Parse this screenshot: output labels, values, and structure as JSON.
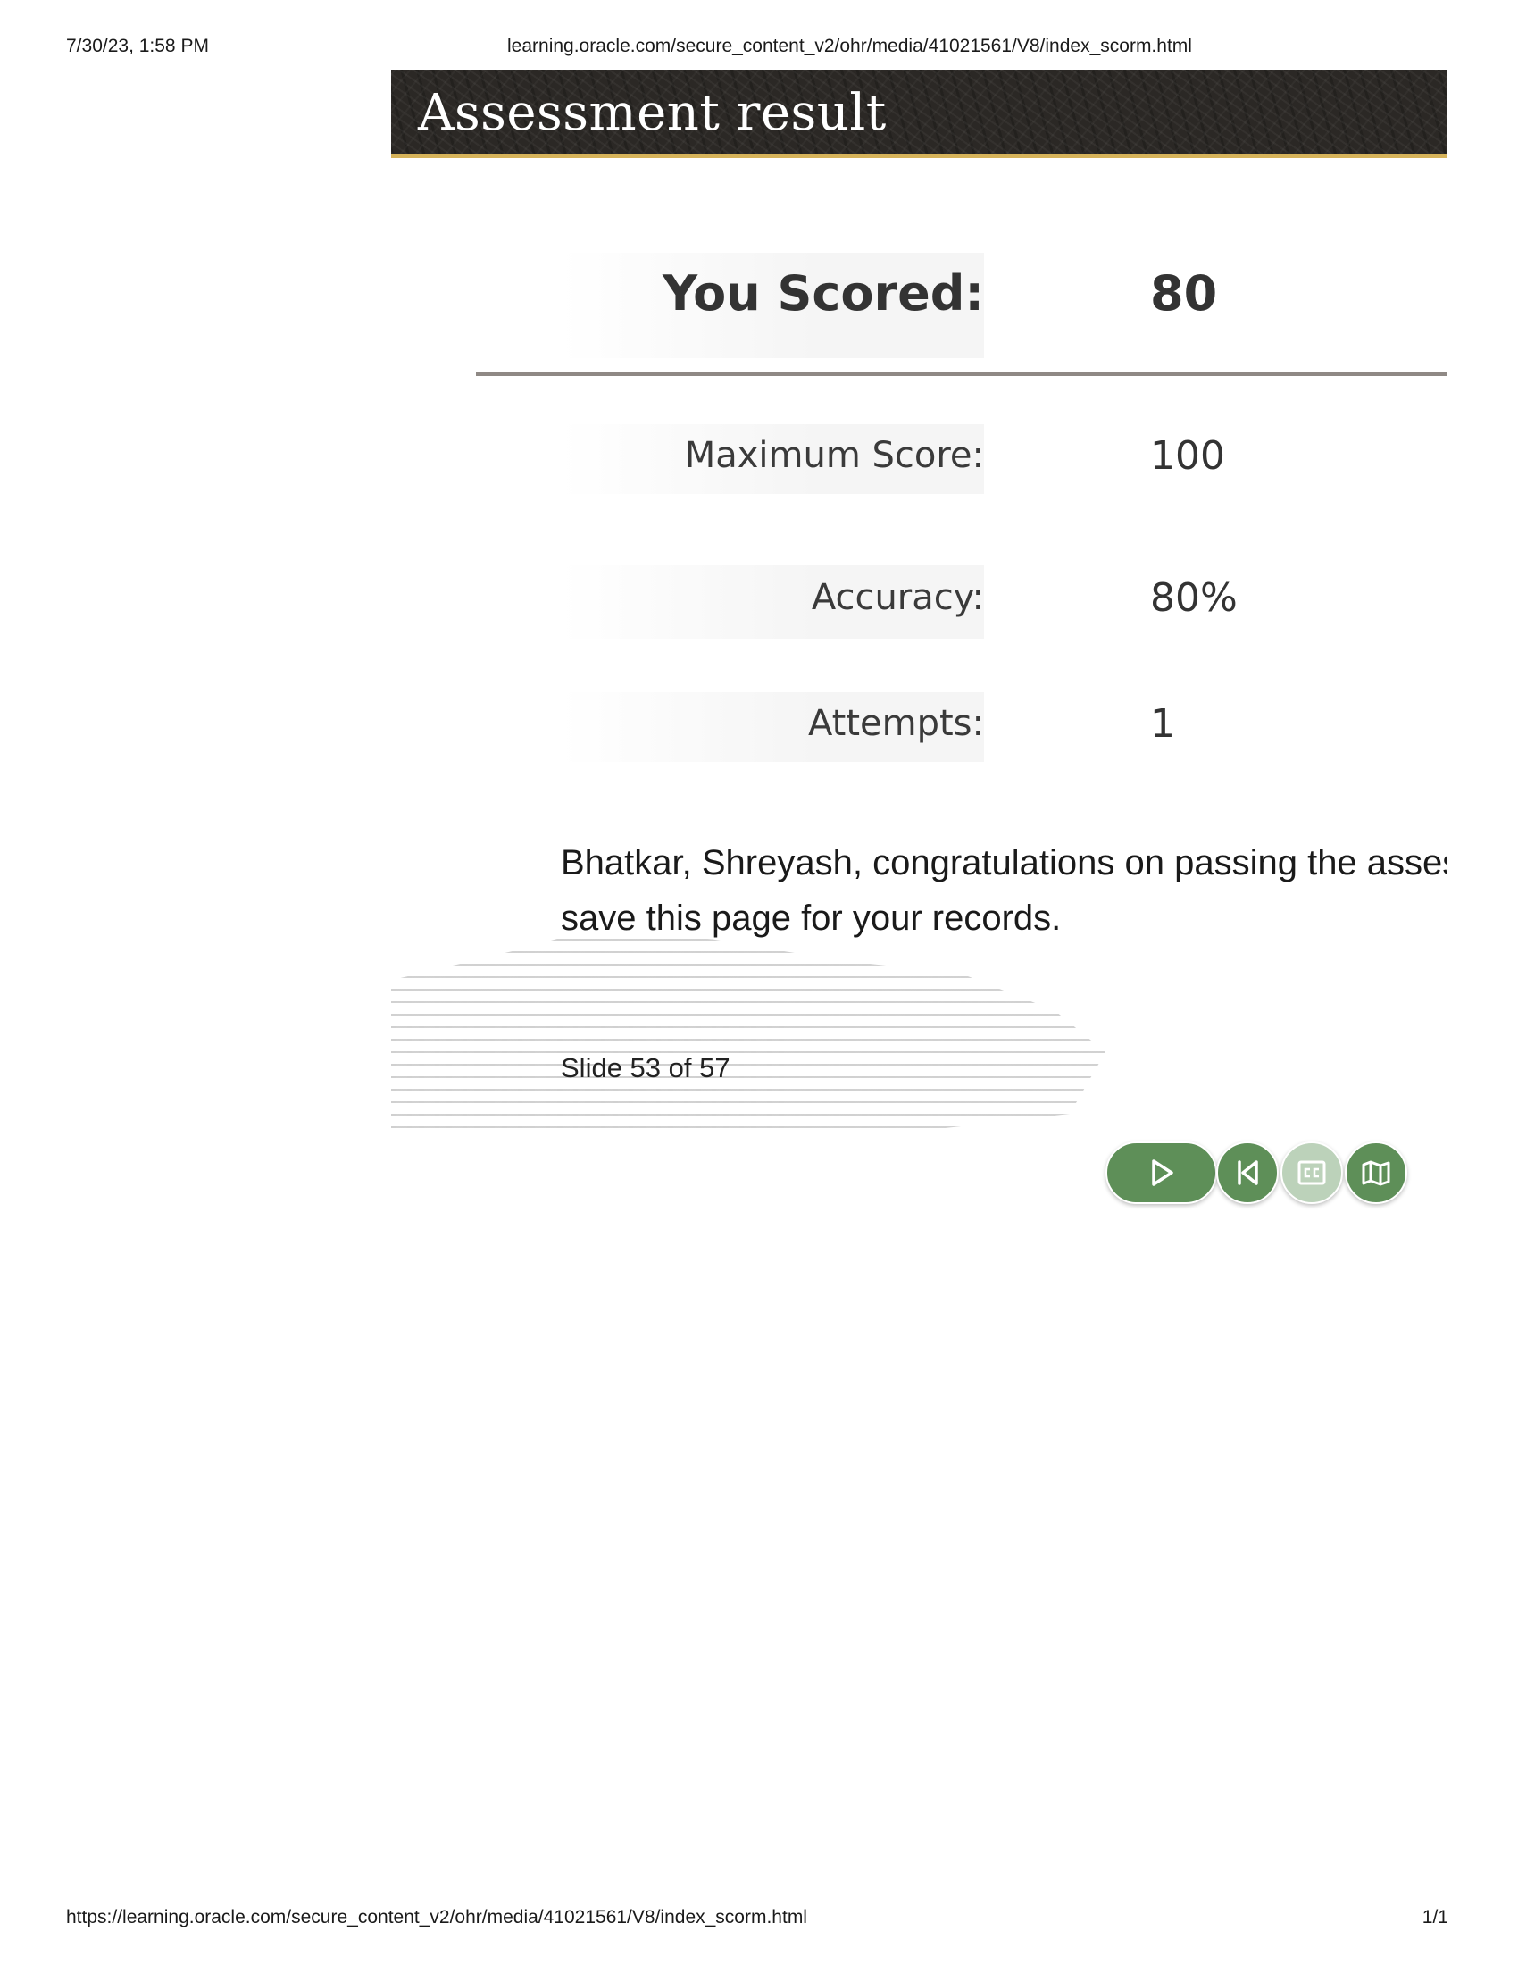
{
  "print_header": {
    "datetime": "7/30/23, 1:58 PM",
    "url": "learning.oracle.com/secure_content_v2/ohr/media/41021561/V8/index_scorm.html"
  },
  "print_footer": {
    "url": "https://learning.oracle.com/secure_content_v2/ohr/media/41021561/V8/index_scorm.html",
    "page": "1/1"
  },
  "slide": {
    "title": "Assessment result",
    "results": {
      "you_scored_label": "You Scored:",
      "you_scored_value": "80",
      "maximum_score_label": "Maximum Score:",
      "maximum_score_value": "100",
      "accuracy_label": "Accuracy:",
      "accuracy_value": "80%",
      "attempts_label": "Attempts:",
      "attempts_value": "1"
    },
    "message_line1": "Bhatkar, Shreyash, congratulations on passing the assessment! Please",
    "message_line2": "save this page for your records.",
    "counter": "Slide  53 of 57"
  },
  "controls": {
    "accent_color": "#5e8f58",
    "cc_disabled_color": "#bcd2ba",
    "icons": [
      "play-icon",
      "skip-back-icon",
      "closed-captions-icon",
      "map-icon"
    ]
  }
}
